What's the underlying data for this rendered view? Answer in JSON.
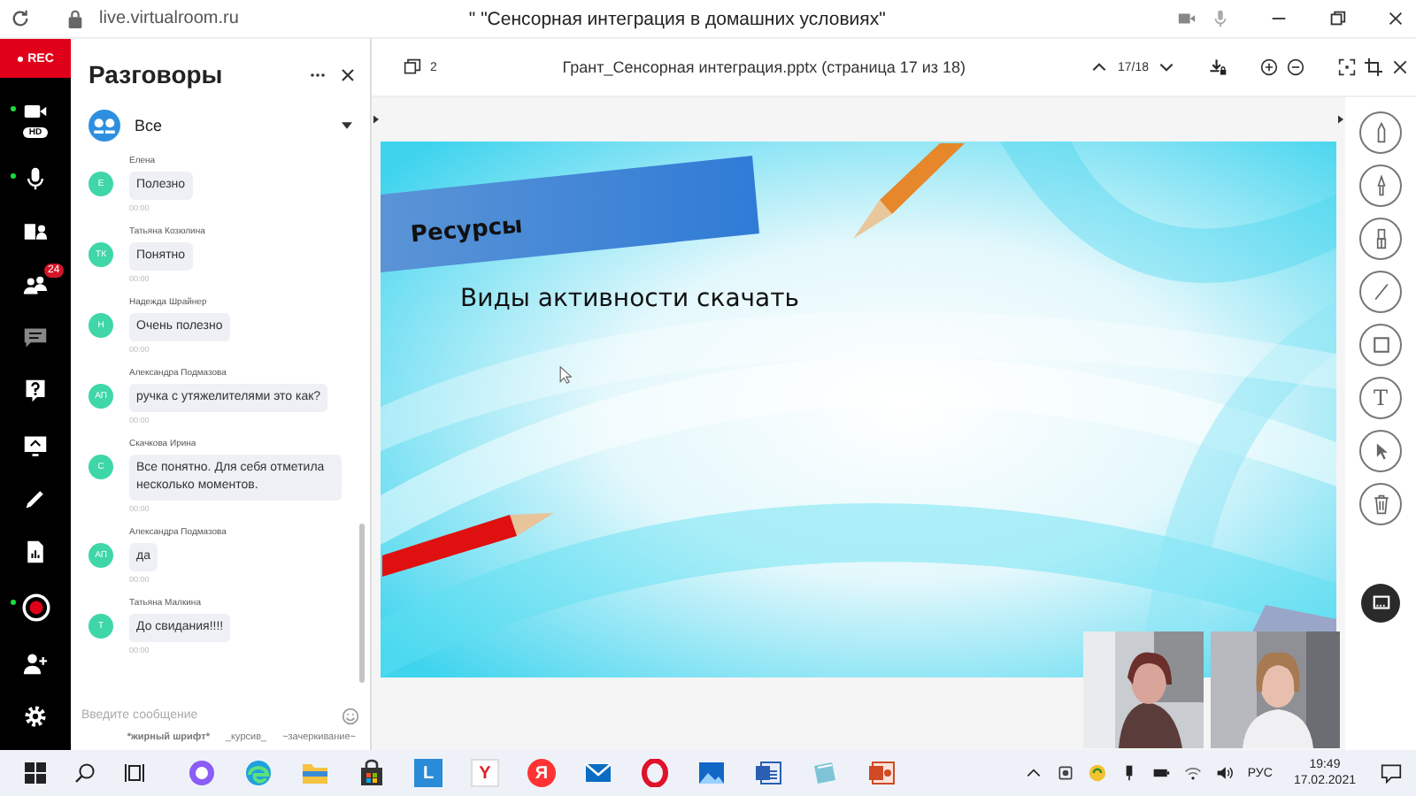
{
  "browser": {
    "url": "live.virtualroom.ru",
    "title": "\" \"Сенсорная интеграция в домашних условиях\""
  },
  "rail": {
    "rec": "REC",
    "items": [
      {
        "kind": "camera",
        "live": true,
        "tag": "HD"
      },
      {
        "kind": "mic",
        "live": true
      },
      {
        "kind": "layout",
        "live": false
      },
      {
        "kind": "participants",
        "live": false,
        "badge": "24"
      },
      {
        "kind": "chat",
        "live": false
      },
      {
        "kind": "question",
        "live": false
      },
      {
        "kind": "screen",
        "live": false
      },
      {
        "kind": "pen",
        "live": false
      },
      {
        "kind": "file",
        "live": false
      },
      {
        "kind": "record",
        "live": true
      },
      {
        "kind": "add-user",
        "live": false
      },
      {
        "kind": "settings",
        "live": false
      }
    ]
  },
  "chat": {
    "title": "Разговоры",
    "audience": "Все",
    "messages": [
      {
        "author": "Елена",
        "initials": "Е",
        "text": "Полезно",
        "time": "00:00"
      },
      {
        "author": "Татьяна Козюлина",
        "initials": "ТК",
        "text": "Понятно",
        "time": "00:00"
      },
      {
        "author": "Надежда Шрайнер",
        "initials": "Н",
        "text": "Очень полезно",
        "time": "00:00"
      },
      {
        "author": "Александра Подмазова",
        "initials": "АП",
        "text": "ручка с утяжелителями это как?",
        "time": "00:00"
      },
      {
        "author": "Скачкова Ирина",
        "initials": "С",
        "text": "Все понятно. Для себя отметила несколько моментов.",
        "time": "00:00"
      },
      {
        "author": "Александра Подмазова",
        "initials": "АП",
        "text": "да",
        "time": "00:00"
      },
      {
        "author": "Татьяна Малкина",
        "initials": "Т",
        "text": "До свидания!!!!",
        "time": "00:00"
      }
    ],
    "placeholder": "Введите сообщение",
    "hints": [
      "*жирный шрифт*",
      "_курсив_",
      "~зачеркивание~"
    ]
  },
  "document": {
    "pages": "2",
    "file": "Грант_Сенсорная интеграция.pptx (страница 17 из 18)",
    "page": "17/18"
  },
  "slide": {
    "heading": "Ресурсы",
    "body": "Виды активности скачать"
  },
  "tools": [
    {
      "kind": "pencil"
    },
    {
      "kind": "brush"
    },
    {
      "kind": "marker"
    },
    {
      "kind": "line"
    },
    {
      "kind": "rectangle"
    },
    {
      "kind": "text",
      "glyph": "T"
    },
    {
      "kind": "pointer"
    },
    {
      "kind": "trash"
    }
  ],
  "taskbar": {
    "apps": [
      {
        "kind": "alice"
      },
      {
        "kind": "edge"
      },
      {
        "kind": "folder"
      },
      {
        "kind": "store"
      },
      {
        "kind": "tile",
        "glyph": "L"
      },
      {
        "kind": "browser",
        "glyph": "Y"
      },
      {
        "kind": "round",
        "glyph": "Я"
      },
      {
        "kind": "mail"
      },
      {
        "kind": "opera"
      },
      {
        "kind": "photos"
      },
      {
        "kind": "word"
      },
      {
        "kind": "notes"
      },
      {
        "kind": "powerpoint"
      }
    ],
    "lang": "РУС",
    "time": "19:49",
    "date": "17.02.2021"
  }
}
